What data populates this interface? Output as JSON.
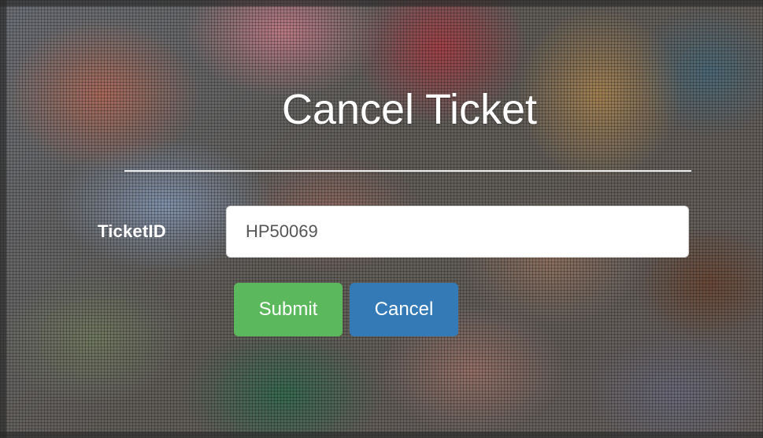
{
  "page": {
    "title": "Cancel Ticket"
  },
  "form": {
    "ticket_label": "TicketID",
    "ticket_value": "HP50069",
    "buttons": {
      "submit_label": "Submit",
      "cancel_label": "Cancel"
    }
  },
  "colors": {
    "title_text": "#ffffff",
    "submit_button": "#5cb85c",
    "cancel_button": "#337ab7",
    "input_background": "#ffffff",
    "input_text": "#555555"
  }
}
